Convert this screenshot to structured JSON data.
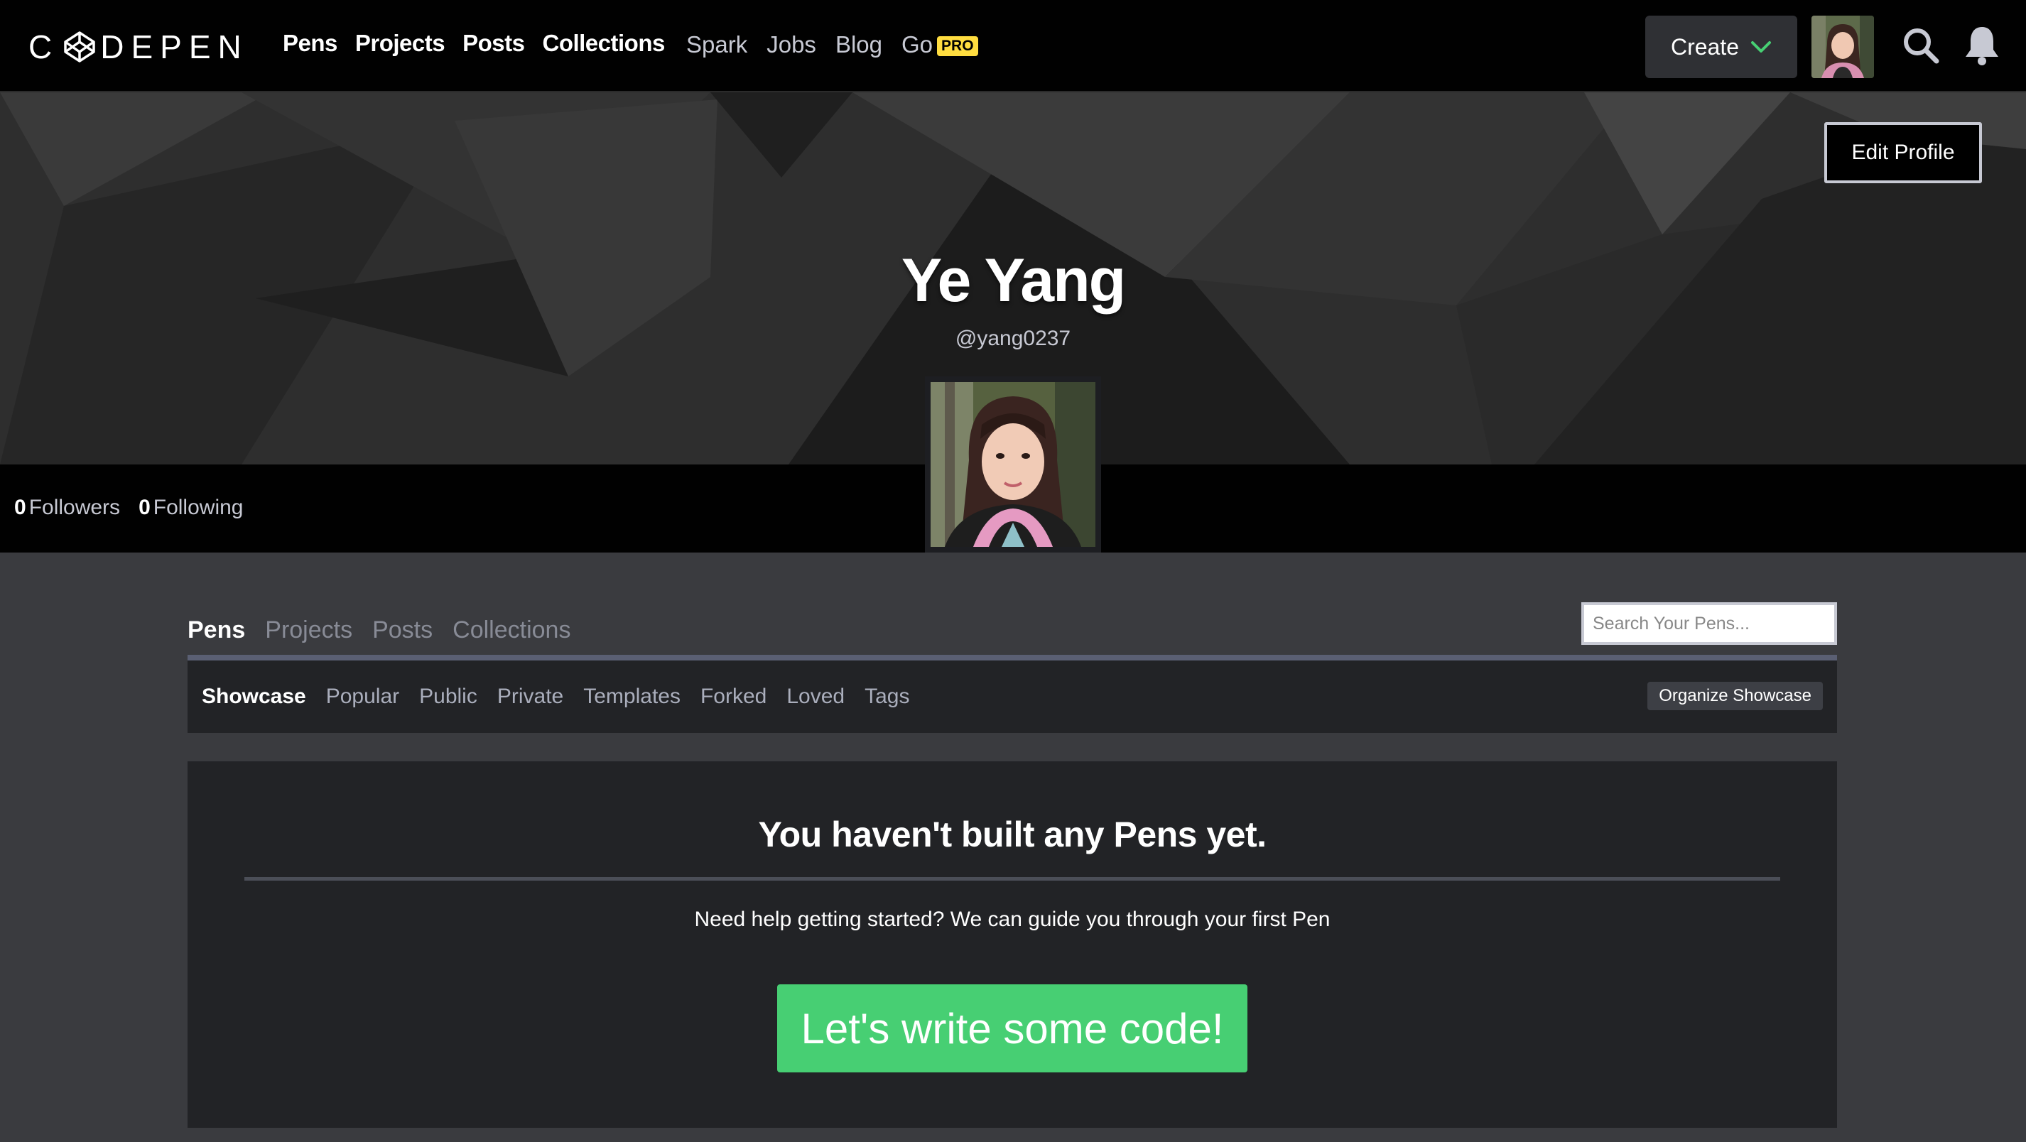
{
  "nav": {
    "logo": "CODEPEN",
    "primary": [
      "Pens",
      "Projects",
      "Posts",
      "Collections"
    ],
    "secondary": [
      "Spark",
      "Jobs",
      "Blog",
      "Go"
    ],
    "pro_badge": "PRO",
    "create_label": "Create",
    "icons": [
      "chevron-down-icon",
      "search-icon",
      "bell-icon"
    ]
  },
  "profile": {
    "name": "Ye Yang",
    "handle": "@yang0237",
    "edit_label": "Edit Profile",
    "followers_count": "0",
    "followers_label": "Followers",
    "following_count": "0",
    "following_label": "Following"
  },
  "content": {
    "tabs": [
      "Pens",
      "Projects",
      "Posts",
      "Collections"
    ],
    "active_tab": "Pens",
    "search_placeholder": "Search Your Pens...",
    "subtabs": [
      "Showcase",
      "Popular",
      "Public",
      "Private",
      "Templates",
      "Forked",
      "Loved",
      "Tags"
    ],
    "active_subtab": "Showcase",
    "organize_label": "Organize Showcase"
  },
  "empty_state": {
    "title": "You haven't built any Pens yet.",
    "help": "Need help getting started? We can guide you through your first Pen",
    "cta": "Let's write some code!"
  },
  "colors": {
    "accent_green": "#47cf73",
    "pro_yellow": "#ffdd40",
    "nav_bg": "#010101",
    "panel_bg": "#222326",
    "page_bg": "#3a3b3f"
  }
}
